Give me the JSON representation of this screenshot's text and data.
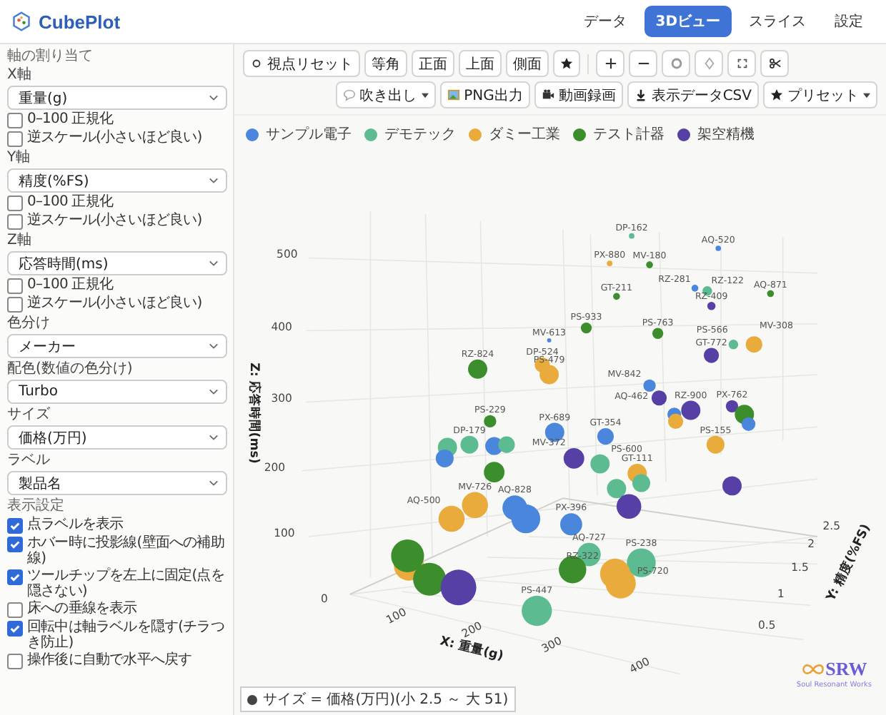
{
  "app": {
    "name": "CubePlot"
  },
  "nav": [
    {
      "label": "データ",
      "selected": false
    },
    {
      "label": "3Dビュー",
      "selected": true
    },
    {
      "label": "スライス",
      "selected": false
    },
    {
      "label": "設定",
      "selected": false
    }
  ],
  "sidebar": {
    "title": "軸の割り当て",
    "axes": [
      {
        "label": "X軸",
        "value": "重量(g)",
        "options": [
          {
            "label": "0–100 正規化",
            "checked": false
          },
          {
            "label": "逆スケール(小さいほど良い)",
            "checked": false
          }
        ]
      },
      {
        "label": "Y軸",
        "value": "精度(%FS)",
        "options": [
          {
            "label": "0–100 正規化",
            "checked": false
          },
          {
            "label": "逆スケール(小さいほど良い)",
            "checked": false
          }
        ]
      },
      {
        "label": "Z軸",
        "value": "応答時間(ms)",
        "options": [
          {
            "label": "0–100 正規化",
            "checked": false
          },
          {
            "label": "逆スケール(小さいほど良い)",
            "checked": false
          }
        ]
      }
    ],
    "selects": [
      {
        "label": "色分け",
        "value": "メーカー"
      },
      {
        "label": "配色(数値の色分け)",
        "value": "Turbo"
      },
      {
        "label": "サイズ",
        "value": "価格(万円)"
      },
      {
        "label": "ラベル",
        "value": "製品名"
      }
    ],
    "display_title": "表示設定",
    "display_options": [
      {
        "label": "点ラベルを表示",
        "checked": true
      },
      {
        "label": "ホバー時に投影線(壁面への補助線)",
        "checked": true
      },
      {
        "label": "ツールチップを左上に固定(点を隠さない)",
        "checked": true
      },
      {
        "label": "床への垂線を表示",
        "checked": false
      },
      {
        "label": "回転中は軸ラベルを隠す(チラつき防止)",
        "checked": true
      },
      {
        "label": "操作後に自動で水平へ戻す",
        "checked": false
      }
    ]
  },
  "toolbar": {
    "view_buttons": [
      {
        "kind": "reset",
        "label": "視点リセット"
      },
      {
        "kind": "text",
        "label": "等角"
      },
      {
        "kind": "text",
        "label": "正面"
      },
      {
        "kind": "text",
        "label": "上面"
      },
      {
        "kind": "text",
        "label": "側面"
      },
      {
        "kind": "star"
      }
    ],
    "tool_buttons": [
      {
        "kind": "plus"
      },
      {
        "kind": "minus"
      },
      {
        "kind": "ring"
      },
      {
        "kind": "diamond"
      },
      {
        "kind": "frame"
      },
      {
        "kind": "scissors"
      }
    ],
    "actions": [
      {
        "kind": "bubble",
        "label": "吹き出し",
        "menu": true
      },
      {
        "kind": "image",
        "label": "PNG出力",
        "menu": false
      },
      {
        "kind": "film",
        "label": "動画録画",
        "menu": false
      },
      {
        "kind": "download",
        "label": "表示データCSV",
        "menu": false
      },
      {
        "kind": "star",
        "label": "プリセット",
        "menu": true
      }
    ]
  },
  "legend": [
    {
      "label": "サンプル電子",
      "color": "#4a86dc"
    },
    {
      "label": "デモテック",
      "color": "#5dbb92"
    },
    {
      "label": "ダミー工業",
      "color": "#e9ab3b"
    },
    {
      "label": "テスト計器",
      "color": "#3b8e2b"
    },
    {
      "label": "架空精機",
      "color": "#5640a6"
    }
  ],
  "plot": {
    "z_title": "Z: 応答時間(ms)",
    "x_title": "X: 重量(g)",
    "y_title": "Y: 精度(%FS)",
    "z_ticks": [
      "500",
      "400",
      "300",
      "200",
      "100",
      "0"
    ],
    "x_ticks": [
      "100",
      "200",
      "300",
      "400"
    ],
    "y_ticks": [
      "2.5",
      "2",
      "1.5",
      "1",
      "0.5"
    ],
    "points": [
      {
        "label": "DP-162",
        "color": "#5dbb92"
      },
      {
        "label": "AQ-520",
        "color": "#4a86dc"
      },
      {
        "label": "PX-880",
        "color": "#e9ab3b"
      },
      {
        "label": "MV-180",
        "color": "#3b8e2b"
      },
      {
        "label": "RZ-281",
        "color": "#4a86dc"
      },
      {
        "label": "RZ-122",
        "color": "#5dbb92"
      },
      {
        "label": "RZ-409",
        "color": "#5640a6"
      },
      {
        "label": "GT-211",
        "color": "#3b8e2b"
      },
      {
        "label": "AQ-871",
        "color": "#3b8e2b"
      },
      {
        "label": "PS-933",
        "color": "#3b8e2b"
      },
      {
        "label": "MV-613",
        "color": "#4a86dc"
      },
      {
        "label": "PS-763",
        "color": "#3b8e2b"
      },
      {
        "label": "PS-566",
        "color": "#5dbb92"
      },
      {
        "label": "MV-308",
        "color": "#e9ab3b"
      },
      {
        "label": "GT-772",
        "color": "#5640a6"
      },
      {
        "label": "RZ-824",
        "color": "#3b8e2b"
      },
      {
        "label": "DP-524",
        "color": "#e9ab3b"
      },
      {
        "label": "PS-479",
        "color": "#e9ab3b"
      },
      {
        "label": "MV-842",
        "color": "#4a86dc"
      },
      {
        "label": "AQ-462",
        "color": "#5640a6"
      },
      {
        "color": "#4a86dc"
      },
      {
        "label": "RZ-900",
        "color": "#5640a6"
      },
      {
        "color": "#e9ab3b"
      },
      {
        "label": "PX-762",
        "color": "#5640a6"
      },
      {
        "color": "#3b8e2b"
      },
      {
        "color": "#4a86dc"
      },
      {
        "label": "PS-229",
        "color": "#3b8e2b"
      },
      {
        "label": "PX-689",
        "color": "#4a86dc"
      },
      {
        "label": "GT-354",
        "color": "#4a86dc"
      },
      {
        "color": "#5dbb92"
      },
      {
        "label": "DP-179",
        "color": "#5dbb92"
      },
      {
        "color": "#4a86dc"
      },
      {
        "color": "#5dbb92"
      },
      {
        "color": "#4a86dc"
      },
      {
        "color": "#3b8e2b"
      },
      {
        "label": "MV-372",
        "color": "#5640a6"
      },
      {
        "label": "PS-600",
        "color": "#5dbb92"
      },
      {
        "label": "GT-111",
        "color": "#e9ab3b"
      },
      {
        "color": "#5dbb92"
      },
      {
        "color": "#5dbb92"
      },
      {
        "label": "PS-155",
        "color": "#e9ab3b"
      },
      {
        "color": "#5640a6"
      },
      {
        "color": "#5640a6"
      },
      {
        "label": "MV-726",
        "color": "#e9ab3b"
      },
      {
        "label": "AQ-500",
        "color": "#e9ab3b"
      },
      {
        "label": "AQ-828",
        "color": "#4a86dc"
      },
      {
        "color": "#4a86dc"
      },
      {
        "label": "PX-396",
        "color": "#4a86dc"
      },
      {
        "label": "AQ-727",
        "color": "#5dbb92"
      },
      {
        "label": "PS-238",
        "color": "#5dbb92"
      },
      {
        "color": "#3b8e2b"
      },
      {
        "label": "RZ-322",
        "color": "#e9ab3b"
      },
      {
        "label": "PS-720",
        "color": "#e9ab3b"
      },
      {
        "color": "#e9ab3b"
      },
      {
        "color": "#3b8e2b"
      },
      {
        "color": "#3b8e2b"
      },
      {
        "color": "#5640a6"
      },
      {
        "label": "PS-447",
        "color": "#5dbb92"
      }
    ],
    "size_note": "サイズ = 価格(万円)(小 2.5 ～ 大 51)",
    "brand": {
      "name": "SRW",
      "tagline": "Soul Resonant Works"
    }
  }
}
